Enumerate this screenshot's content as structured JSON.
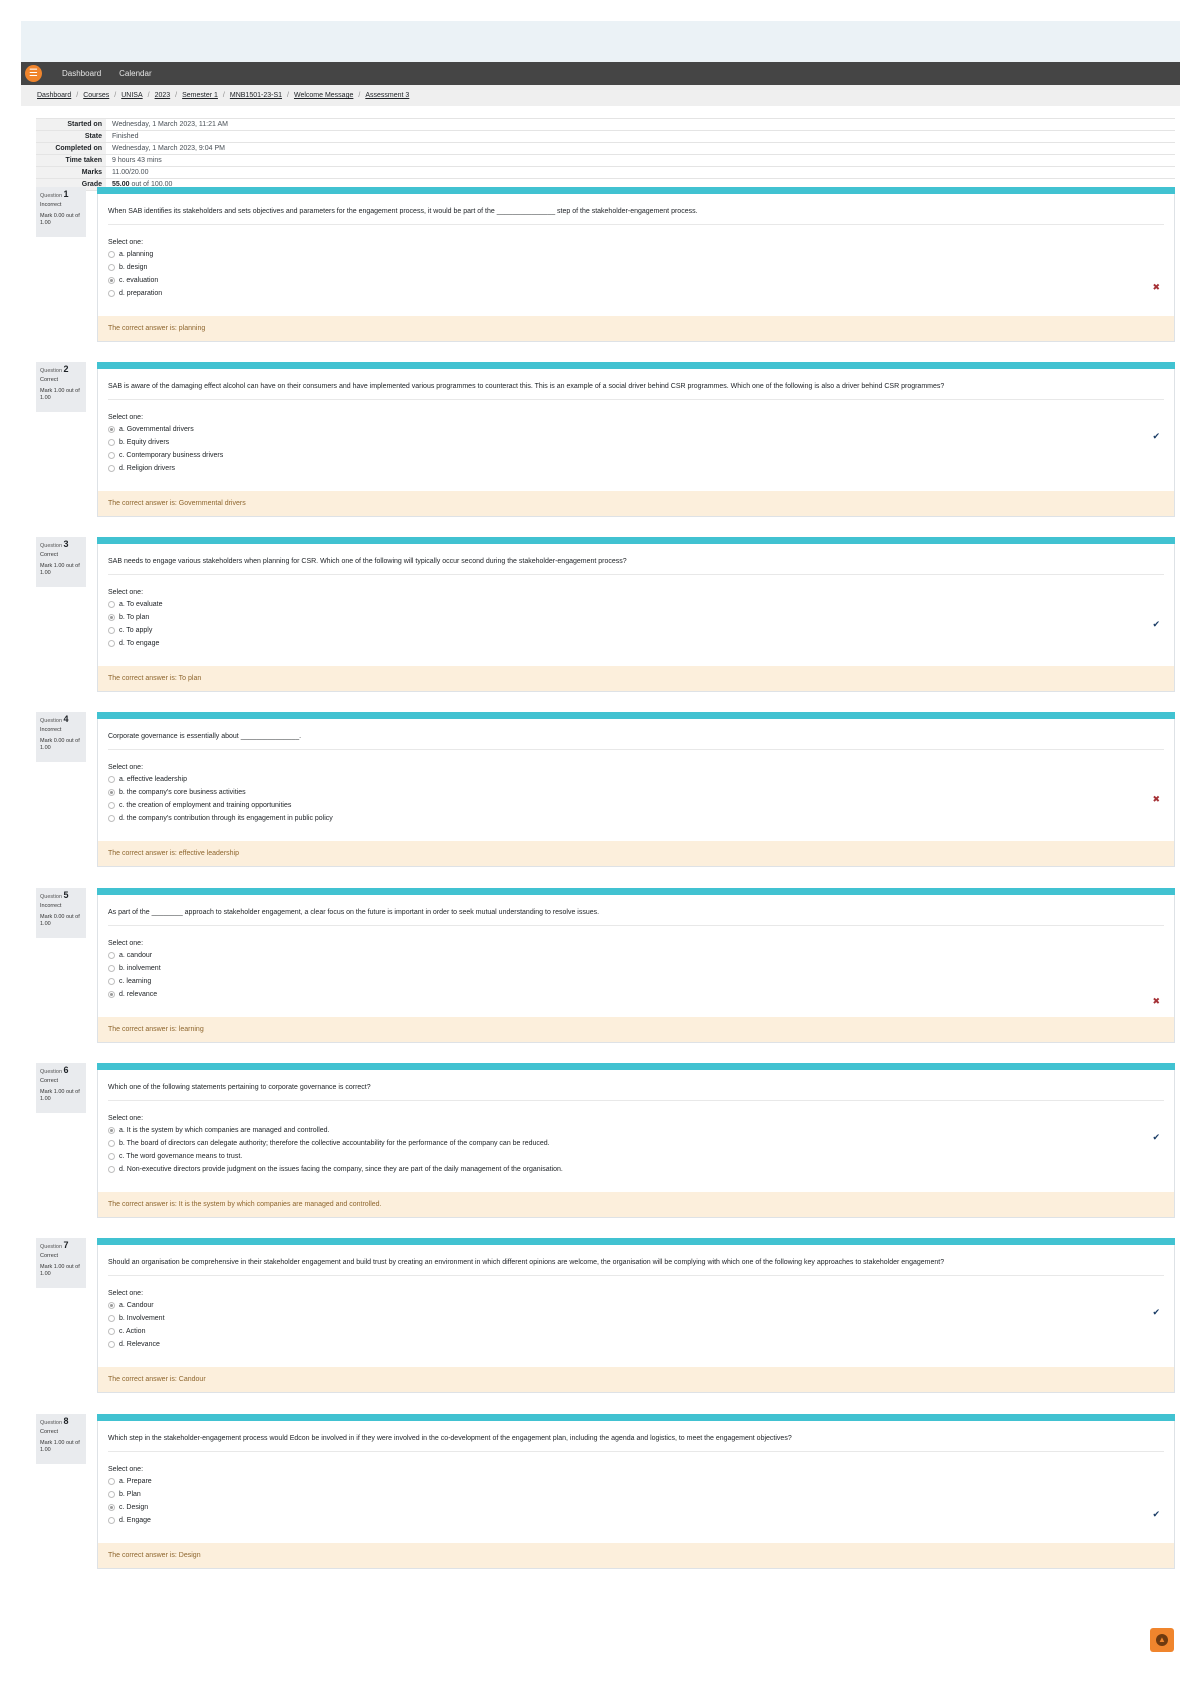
{
  "nav": {
    "menu_icon": "hamburger-icon",
    "dashboard": "Dashboard",
    "calendar": "Calendar"
  },
  "breadcrumb": [
    "Dashboard",
    "Courses",
    "UNISA",
    "2023",
    "Semester 1",
    "MNB1501-23-S1",
    "Welcome Message",
    "Assessment 3"
  ],
  "summary": {
    "started_on_label": "Started on",
    "started_on": "Wednesday, 1 March 2023, 11:21 AM",
    "state_label": "State",
    "state": "Finished",
    "completed_on_label": "Completed on",
    "completed_on": "Wednesday, 1 March 2023, 9:04 PM",
    "time_taken_label": "Time taken",
    "time_taken": "9 hours 43 mins",
    "marks_label": "Marks",
    "marks": "11.00/20.00",
    "grade_label": "Grade",
    "grade_value": "55.00",
    "grade_suffix": "out of 100.00"
  },
  "question_label": "Question",
  "select_one": "Select one:",
  "questions": [
    {
      "number": "1",
      "state": "Incorrect",
      "mark": "Mark 0.00 out of 1.00",
      "text": "When SAB identifies its stakeholders and sets objectives and parameters for the engagement process, it would be part of the _______________ step of the stakeholder-engagement process.",
      "options": [
        "a. planning",
        "b. design",
        "c. evaluation",
        "d. preparation"
      ],
      "selected": 2,
      "result": "wrong",
      "answer": "The correct answer is: planning"
    },
    {
      "number": "2",
      "state": "Correct",
      "mark": "Mark 1.00 out of 1.00",
      "text": "SAB is aware of the damaging effect alcohol can have on their consumers and have implemented various programmes to counteract this. This is an example of a social driver behind CSR programmes. Which one of the following is also a driver behind CSR programmes?",
      "options": [
        "a. Governmental drivers",
        "b. Equity drivers",
        "c. Contemporary business drivers",
        "d. Religion drivers"
      ],
      "selected": 0,
      "result": "right",
      "answer": "The correct answer is: Governmental drivers"
    },
    {
      "number": "3",
      "state": "Correct",
      "mark": "Mark 1.00 out of 1.00",
      "text": "SAB needs to engage various stakeholders when planning for CSR. Which one of the following will typically occur second during the stakeholder-engagement process?",
      "options": [
        "a. To evaluate",
        "b. To plan",
        "c. To apply",
        "d. To engage"
      ],
      "selected": 1,
      "result": "right",
      "answer": "The correct answer is: To plan"
    },
    {
      "number": "4",
      "state": "Incorrect",
      "mark": "Mark 0.00 out of 1.00",
      "text": "Corporate governance is essentially about _______________.",
      "options": [
        "a. effective leadership",
        "b. the company's core business activities",
        "c. the creation of employment and training opportunities",
        "d. the company's contribution through its engagement in public policy"
      ],
      "selected": 1,
      "result": "wrong",
      "answer": "The correct answer is: effective leadership"
    },
    {
      "number": "5",
      "state": "Incorrect",
      "mark": "Mark 0.00 out of 1.00",
      "text": "As part of the ________ approach to stakeholder engagement, a clear focus on the future is important in order to seek mutual understanding to resolve issues.",
      "options": [
        "a. candour",
        "b. inolvement",
        "c. learning",
        "d. relevance"
      ],
      "selected": 3,
      "result": "wrong",
      "answer": "The correct answer is: learning"
    },
    {
      "number": "6",
      "state": "Correct",
      "mark": "Mark 1.00 out of 1.00",
      "text": "Which one of the following statements pertaining to corporate governance is correct?",
      "options": [
        "a. It is the system by which companies are managed and controlled.",
        "b. The board of directors can delegate authority; therefore the collective accountability for the performance of the company can be reduced.",
        "c. The word governance means to trust.",
        "d. Non-executive directors provide judgment on the issues facing the company, since they are part of the daily management of the organisation."
      ],
      "selected": 0,
      "result": "right",
      "answer": "The correct answer is: It is the system by which companies are managed and controlled."
    },
    {
      "number": "7",
      "state": "Correct",
      "mark": "Mark 1.00 out of 1.00",
      "text": "Should an organisation be comprehensive in their stakeholder engagement and build trust by creating an environment in which different opinions are welcome, the organisation will be complying with which one of the following key approaches to stakeholder engagement?",
      "options": [
        "a. Candour",
        "b. Involvement",
        "c. Action",
        "d. Relevance"
      ],
      "selected": 0,
      "result": "right",
      "answer": "The correct answer is: Candour"
    },
    {
      "number": "8",
      "state": "Correct",
      "mark": "Mark 1.00 out of 1.00",
      "text": "Which step in the stakeholder-engagement process would Edcon be involved in if they were involved in the co-development of the engagement plan, including the agenda and logistics, to meet the engagement objectives?",
      "options": [
        "a. Prepare",
        "b. Plan",
        "c. Design",
        "d. Engage"
      ],
      "selected": 2,
      "result": "right",
      "answer": "The correct answer is: Design"
    }
  ],
  "icons": {
    "wrong": "✖",
    "right": "✔",
    "scroll_top": "▲"
  },
  "colors": {
    "accent": "#41c2d1",
    "brand_orange": "#f0852d",
    "answer_bg": "#fcefdc"
  }
}
